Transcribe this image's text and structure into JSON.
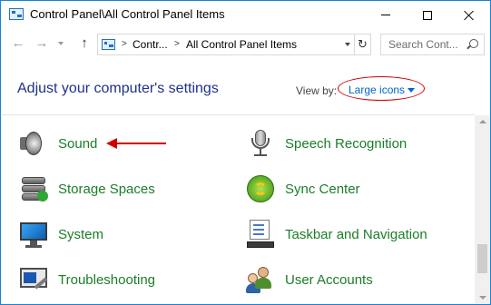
{
  "window": {
    "title": "Control Panel\\All Control Panel Items"
  },
  "address": {
    "crumbs": [
      "Contr...",
      "All Control Panel Items"
    ],
    "separator": ">"
  },
  "search": {
    "placeholder": "Search Cont..."
  },
  "header": {
    "title": "Adjust your computer's settings",
    "view_by_label": "View by:",
    "view_by_value": "Large icons"
  },
  "items": {
    "left": [
      {
        "label": "Sound",
        "icon": "speaker-icon"
      },
      {
        "label": "Storage Spaces",
        "icon": "storage-spaces-icon"
      },
      {
        "label": "System",
        "icon": "monitor-icon"
      },
      {
        "label": "Troubleshooting",
        "icon": "troubleshooting-icon"
      }
    ],
    "right": [
      {
        "label": "Speech Recognition",
        "icon": "microphone-icon"
      },
      {
        "label": "Sync Center",
        "icon": "sync-icon"
      },
      {
        "label": "Taskbar and Navigation",
        "icon": "taskbar-icon"
      },
      {
        "label": "User Accounts",
        "icon": "users-icon"
      }
    ]
  },
  "colors": {
    "link_green": "#1a7e28",
    "title_blue": "#1e3287",
    "annotation_red": "#d00000",
    "accent_blue": "#0066cc"
  }
}
